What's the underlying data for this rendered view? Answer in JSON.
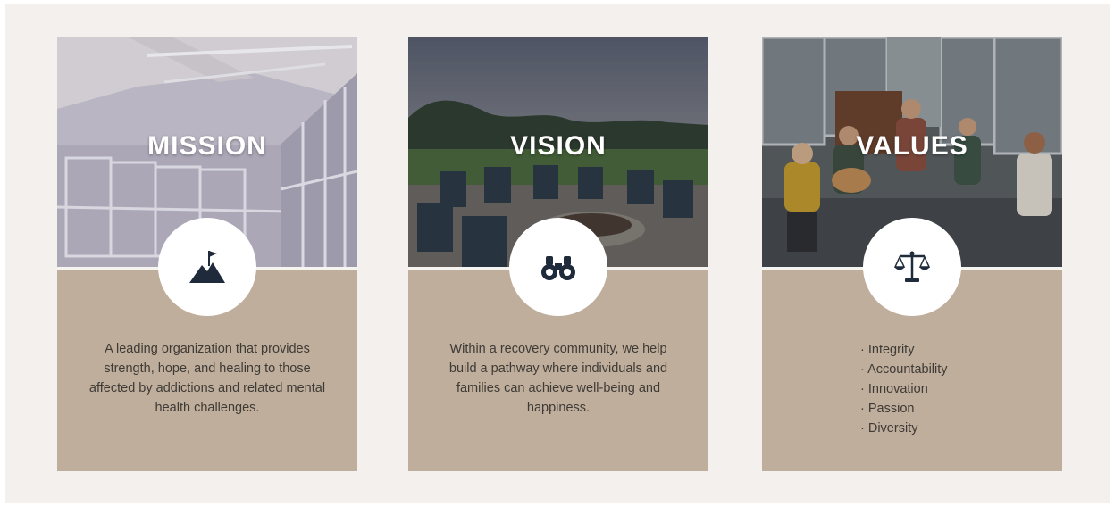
{
  "cards": [
    {
      "title": "MISSION",
      "icon": "mountain-flag-icon",
      "text": "A leading organization that provides strength, hope, and healing to those affected by addictions and related mental health challenges."
    },
    {
      "title": "VISION",
      "icon": "binoculars-icon",
      "text": "Within a recovery community, we help build a pathway where individuals and families can achieve well-being and happiness."
    },
    {
      "title": "VALUES",
      "icon": "scales-icon",
      "items": [
        "Integrity",
        "Accountability",
        "Innovation",
        "Passion",
        "Diversity"
      ]
    }
  ],
  "colors": {
    "background": "#f3f0ed",
    "card_panel": "#bfae9b",
    "icon": "#1f2a3a",
    "text": "#3e3a36"
  }
}
